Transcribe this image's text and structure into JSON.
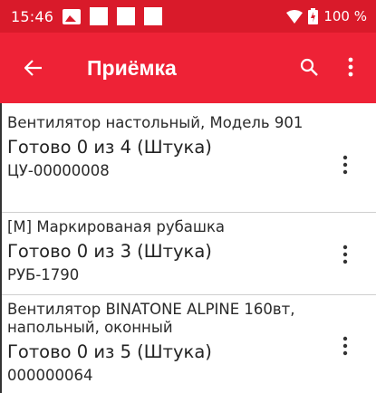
{
  "status_bar": {
    "time": "15:46",
    "battery": "100 %"
  },
  "app_bar": {
    "title": "Приёмка"
  },
  "colors": {
    "status_bar": "#d91a2a",
    "app_bar": "#ee2236"
  },
  "items": [
    {
      "name": "Вентилятор настольный, Модель 901",
      "progress": "Готово 0 из 4 (Штука)",
      "code": "ЦУ-00000008"
    },
    {
      "name": "[М] Маркированая рубашка",
      "progress": "Готово 0 из 3 (Штука)",
      "code": "РУБ-1790"
    },
    {
      "name": "Вентилятор BINATONE ALPINE 160вт, напольный, оконный",
      "progress": "Готово 0 из 5 (Штука)",
      "code": "000000064"
    }
  ]
}
